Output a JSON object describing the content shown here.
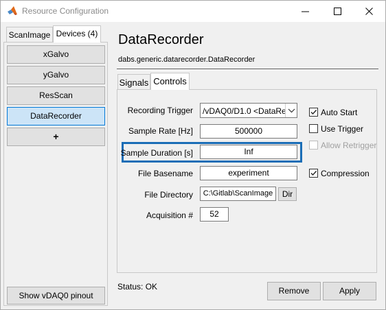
{
  "window": {
    "title": "Resource Configuration"
  },
  "left_tabs": [
    {
      "label": "ScanImage"
    },
    {
      "label": "Devices (4)"
    }
  ],
  "devices": [
    {
      "label": "xGalvo"
    },
    {
      "label": "yGalvo"
    },
    {
      "label": "ResScan"
    },
    {
      "label": "DataRecorder"
    }
  ],
  "add_device_label": "+",
  "pinout_button": "Show vDAQ0 pinout",
  "device": {
    "title": "DataRecorder",
    "class": "dabs.generic.datarecorder.DataRecorder"
  },
  "right_tabs": [
    {
      "label": "Signals"
    },
    {
      "label": "Controls"
    }
  ],
  "fields": {
    "recording_trigger": {
      "label": "Recording Trigger",
      "value": "/vDAQ0/D1.0 <DataRe..."
    },
    "sample_rate": {
      "label": "Sample Rate [Hz]",
      "value": "500000"
    },
    "sample_duration": {
      "label": "Sample Duration [s]",
      "value": "Inf"
    },
    "file_basename": {
      "label": "File Basename",
      "value": "experiment"
    },
    "file_directory": {
      "label": "File Directory",
      "value": "C:\\Gitlab\\ScanImage"
    },
    "acquisition": {
      "label": "Acquisition #",
      "value": "52"
    }
  },
  "dir_button": "Dir",
  "checkboxes": {
    "auto_start": {
      "label": "Auto Start",
      "checked": true
    },
    "use_trigger": {
      "label": "Use Trigger",
      "checked": false
    },
    "allow_retrigger": {
      "label": "Allow Retrigger",
      "checked": false,
      "enabled": false
    },
    "compression": {
      "label": "Compression",
      "checked": true
    }
  },
  "status": "Status: OK",
  "buttons": {
    "remove": "Remove",
    "apply": "Apply"
  },
  "colors": {
    "highlight": "#1a6db6",
    "selected_bg": "#cce4f7",
    "selected_border": "#0078d7"
  }
}
